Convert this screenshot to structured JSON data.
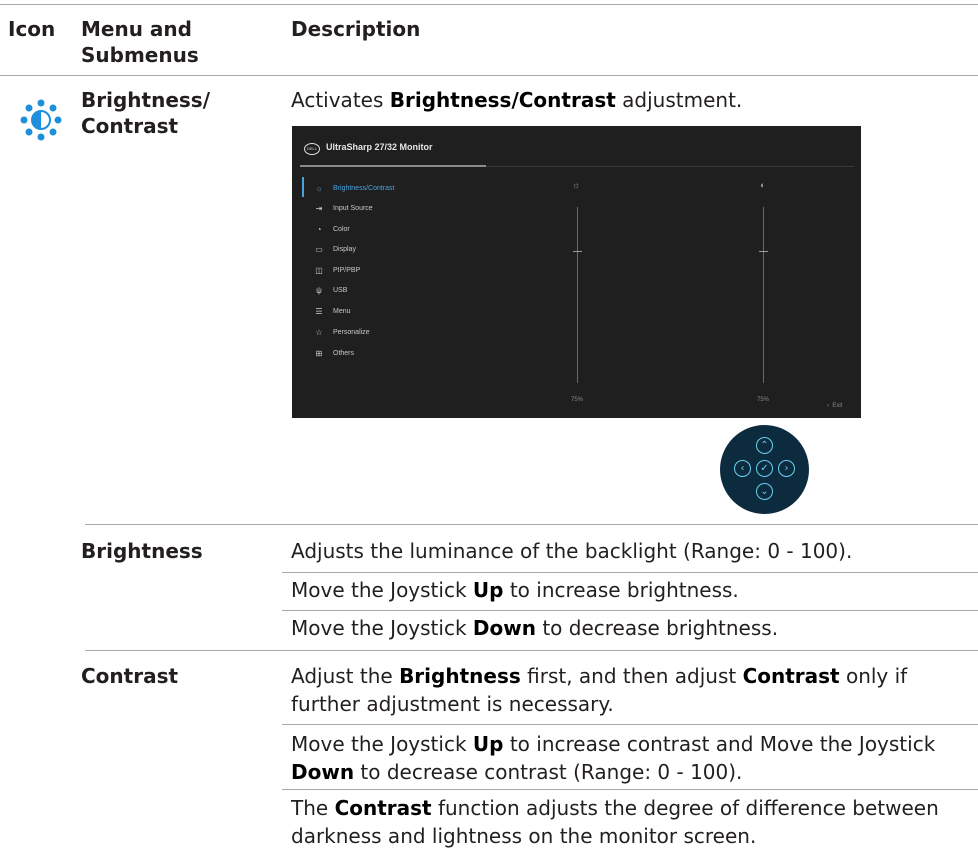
{
  "header": {
    "col_icon": "Icon",
    "col_menu": "Menu and Submenus",
    "col_desc": "Description"
  },
  "row_main": {
    "icon_name": "brightness-contrast-icon",
    "menu_label": "Brightness/ Contrast",
    "desc_prefix": "Activates ",
    "desc_bold": "Brightness/Contrast",
    "desc_suffix": " adjustment."
  },
  "osd": {
    "logo": "DELL",
    "title": "UltraSharp 27/32 Monitor",
    "menu_items": [
      {
        "label": "Brightness/Contrast",
        "icon": "sun-icon",
        "active": true
      },
      {
        "label": "Input Source",
        "icon": "input-icon"
      },
      {
        "label": "Color",
        "icon": "palette-icon"
      },
      {
        "label": "Display",
        "icon": "display-icon"
      },
      {
        "label": "PIP/PBP",
        "icon": "pip-icon"
      },
      {
        "label": "USB",
        "icon": "usb-icon"
      },
      {
        "label": "Menu",
        "icon": "menu-icon"
      },
      {
        "label": "Personalize",
        "icon": "star-icon"
      },
      {
        "label": "Others",
        "icon": "others-icon"
      }
    ],
    "brightness_value": "75%",
    "contrast_value": "75%",
    "exit_label": "Exit",
    "colors": {
      "bg": "#1f1f1f",
      "accent": "#4aa3df"
    }
  },
  "joystick": {
    "icon": "joystick-icon",
    "color": "#0d2b3e",
    "accent": "#6ad1f0"
  },
  "brightness_row": {
    "label": "Brightness",
    "line1": "Adjusts the luminance of the backlight (Range: 0 - 100).",
    "line2_prefix": "Move the Joystick ",
    "line2_bold": "Up",
    "line2_suffix": " to increase brightness.",
    "line3_prefix": "Move the Joystick ",
    "line3_bold": "Down",
    "line3_suffix": " to decrease brightness."
  },
  "contrast_row": {
    "label": "Contrast",
    "p1_a": "Adjust the ",
    "p1_b": "Brightness",
    "p1_c": " first, and then adjust ",
    "p1_d": "Contrast",
    "p1_e": " only if further adjustment is necessary.",
    "p2_a": "Move the Joystick ",
    "p2_b": "Up",
    "p2_c": " to increase contrast and Move the Joystick ",
    "p2_d": "Down",
    "p2_e": " to decrease contrast (Range: 0 - 100).",
    "p3_a": "The ",
    "p3_b": "Contrast",
    "p3_c": " function adjusts the degree of difference between darkness and lightness on the monitor screen."
  }
}
